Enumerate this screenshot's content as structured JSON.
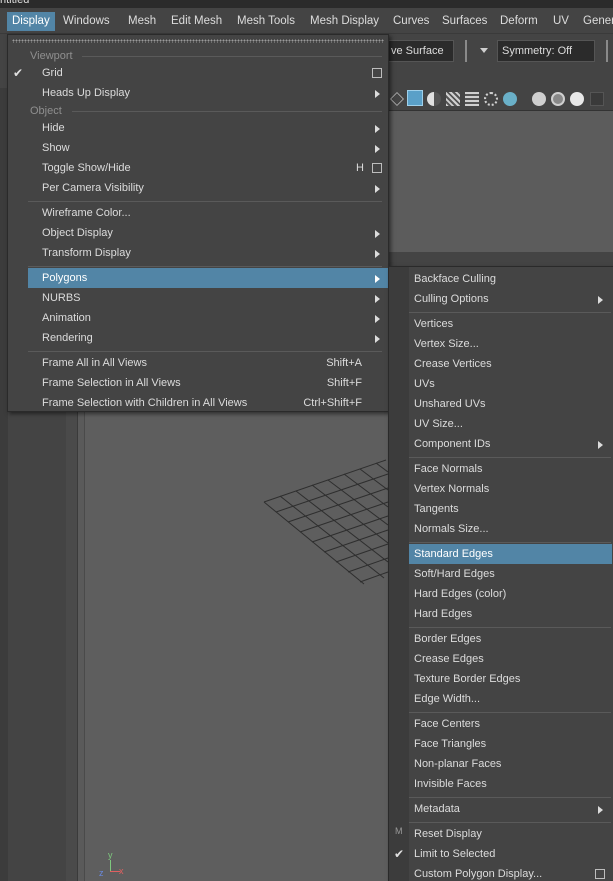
{
  "window": {
    "title": "ntitled"
  },
  "menubar": [
    {
      "label": "Display",
      "active": true
    },
    {
      "label": "Windows"
    },
    {
      "label": "Mesh"
    },
    {
      "label": "Edit Mesh"
    },
    {
      "label": "Mesh Tools"
    },
    {
      "label": "Mesh Display"
    },
    {
      "label": "Curves"
    },
    {
      "label": "Surfaces"
    },
    {
      "label": "Deform"
    },
    {
      "label": "UV"
    },
    {
      "label": "Gener"
    }
  ],
  "toolbar": {
    "live_surface": "ve Surface",
    "symmetry": "Symmetry: Off"
  },
  "display_menu": {
    "sections": {
      "viewport": "Viewport",
      "object": "Object"
    },
    "items": {
      "grid": {
        "label": "Grid",
        "checked": true
      },
      "heads_up": {
        "label": "Heads Up Display"
      },
      "hide": {
        "label": "Hide"
      },
      "show": {
        "label": "Show"
      },
      "toggle_show_hide": {
        "label": "Toggle Show/Hide",
        "shortcut": "H"
      },
      "per_camera": {
        "label": "Per Camera Visibility"
      },
      "wireframe_color": {
        "label": "Wireframe Color..."
      },
      "object_display": {
        "label": "Object Display"
      },
      "transform_display": {
        "label": "Transform Display"
      },
      "polygons": {
        "label": "Polygons"
      },
      "nurbs": {
        "label": "NURBS"
      },
      "animation": {
        "label": "Animation"
      },
      "rendering": {
        "label": "Rendering"
      },
      "frame_all": {
        "label": "Frame All in All Views",
        "shortcut": "Shift+A"
      },
      "frame_selection": {
        "label": "Frame Selection in All Views",
        "shortcut": "Shift+F"
      },
      "frame_children": {
        "label": "Frame Selection with Children in All Views",
        "shortcut": "Ctrl+Shift+F"
      }
    }
  },
  "polygons_menu": {
    "items": {
      "backface_culling": "Backface Culling",
      "culling_options": "Culling Options",
      "vertices": "Vertices",
      "vertex_size": "Vertex Size...",
      "crease_vertices": "Crease Vertices",
      "uvs": "UVs",
      "unshared_uvs": "Unshared UVs",
      "uv_size": "UV Size...",
      "component_ids": "Component IDs",
      "face_normals": "Face Normals",
      "vertex_normals": "Vertex Normals",
      "tangents": "Tangents",
      "normals_size": "Normals Size...",
      "standard_edges": "Standard Edges",
      "soft_hard_edges": "Soft/Hard Edges",
      "hard_edges_color": "Hard Edges (color)",
      "hard_edges": "Hard Edges",
      "border_edges": "Border Edges",
      "crease_edges": "Crease Edges",
      "texture_border_edges": "Texture Border Edges",
      "edge_width": "Edge Width...",
      "face_centers": "Face Centers",
      "face_triangles": "Face Triangles",
      "non_planar_faces": "Non-planar Faces",
      "invisible_faces": "Invisible Faces",
      "metadata": "Metadata",
      "reset_display": "Reset Display",
      "limit_to_selected": "Limit to Selected",
      "custom_polygon_display": "Custom Polygon Display..."
    },
    "limit_checked": true
  },
  "viewport": {
    "axis_y": "y",
    "axis_x": "x",
    "axis_z": "z",
    "side_marker": "M"
  },
  "colors": {
    "accent": "#5285a6",
    "menu_bg": "#444444",
    "text": "#dcdcdc"
  }
}
